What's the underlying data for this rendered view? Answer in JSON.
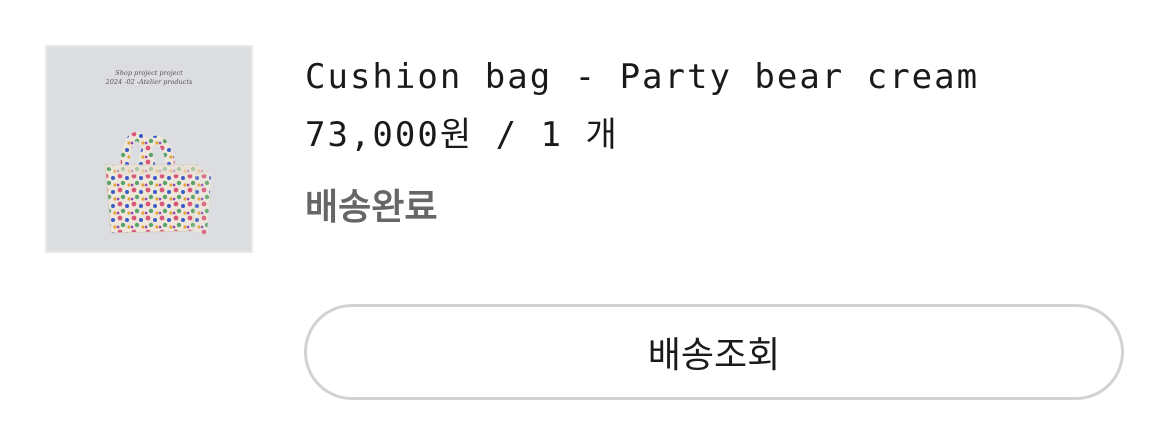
{
  "order_item": {
    "image": {
      "caption_line1": "Shop project project",
      "caption_line2": "2024 -02 -Atelier products",
      "icon": "tote-bag-illustration"
    },
    "product_name": "Cushion bag - Party bear cream",
    "price_quantity": "73,000원 / 1 개",
    "status": "배송완료",
    "track_button_label": "배송조회",
    "colors": {
      "status_text": "#666666",
      "button_border": "#d2d2d2",
      "thumbnail_bg": "#dcdde0"
    }
  }
}
